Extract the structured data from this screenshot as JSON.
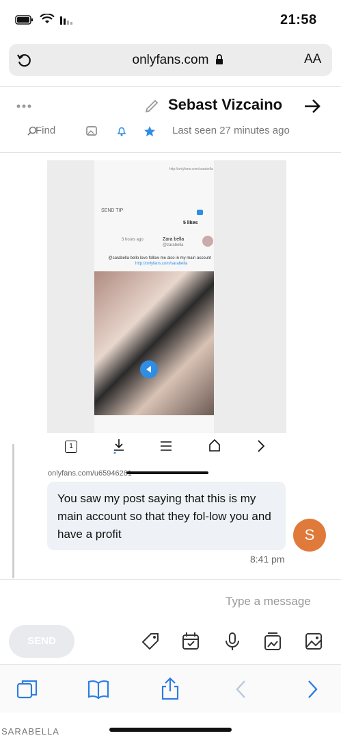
{
  "status": {
    "time": "21:58"
  },
  "browser": {
    "url": "onlyfans.com",
    "text_size": "AA"
  },
  "chat": {
    "contact_name": "Sebast Vizcaino",
    "last_seen": "Last seen 27 minutes ago",
    "find": "Find",
    "message": {
      "url": "onlyfans.com/u65946281",
      "text": "You saw my post saying that this is my main account so that they fol-low you and have a profit",
      "time": "8:41 pm",
      "avatar_letter": "S"
    },
    "composer": {
      "placeholder": "Type a message",
      "send": "SEND"
    }
  },
  "screenshot_preview": {
    "user": "Zara bella",
    "handle": "@zarabella",
    "time_ago": "3 hours ago",
    "caption": "@sarabella bello love follow me also in my main account",
    "link": "http://onlyfans.com/sarabella",
    "send_tip": "SEND TIP",
    "likes": "5 likes",
    "page_num": "1"
  },
  "watermark": "SARABELLA",
  "colors": {
    "accent": "#2f8de4",
    "avatar": "#e07a3a",
    "bubble": "#eef1f5"
  }
}
